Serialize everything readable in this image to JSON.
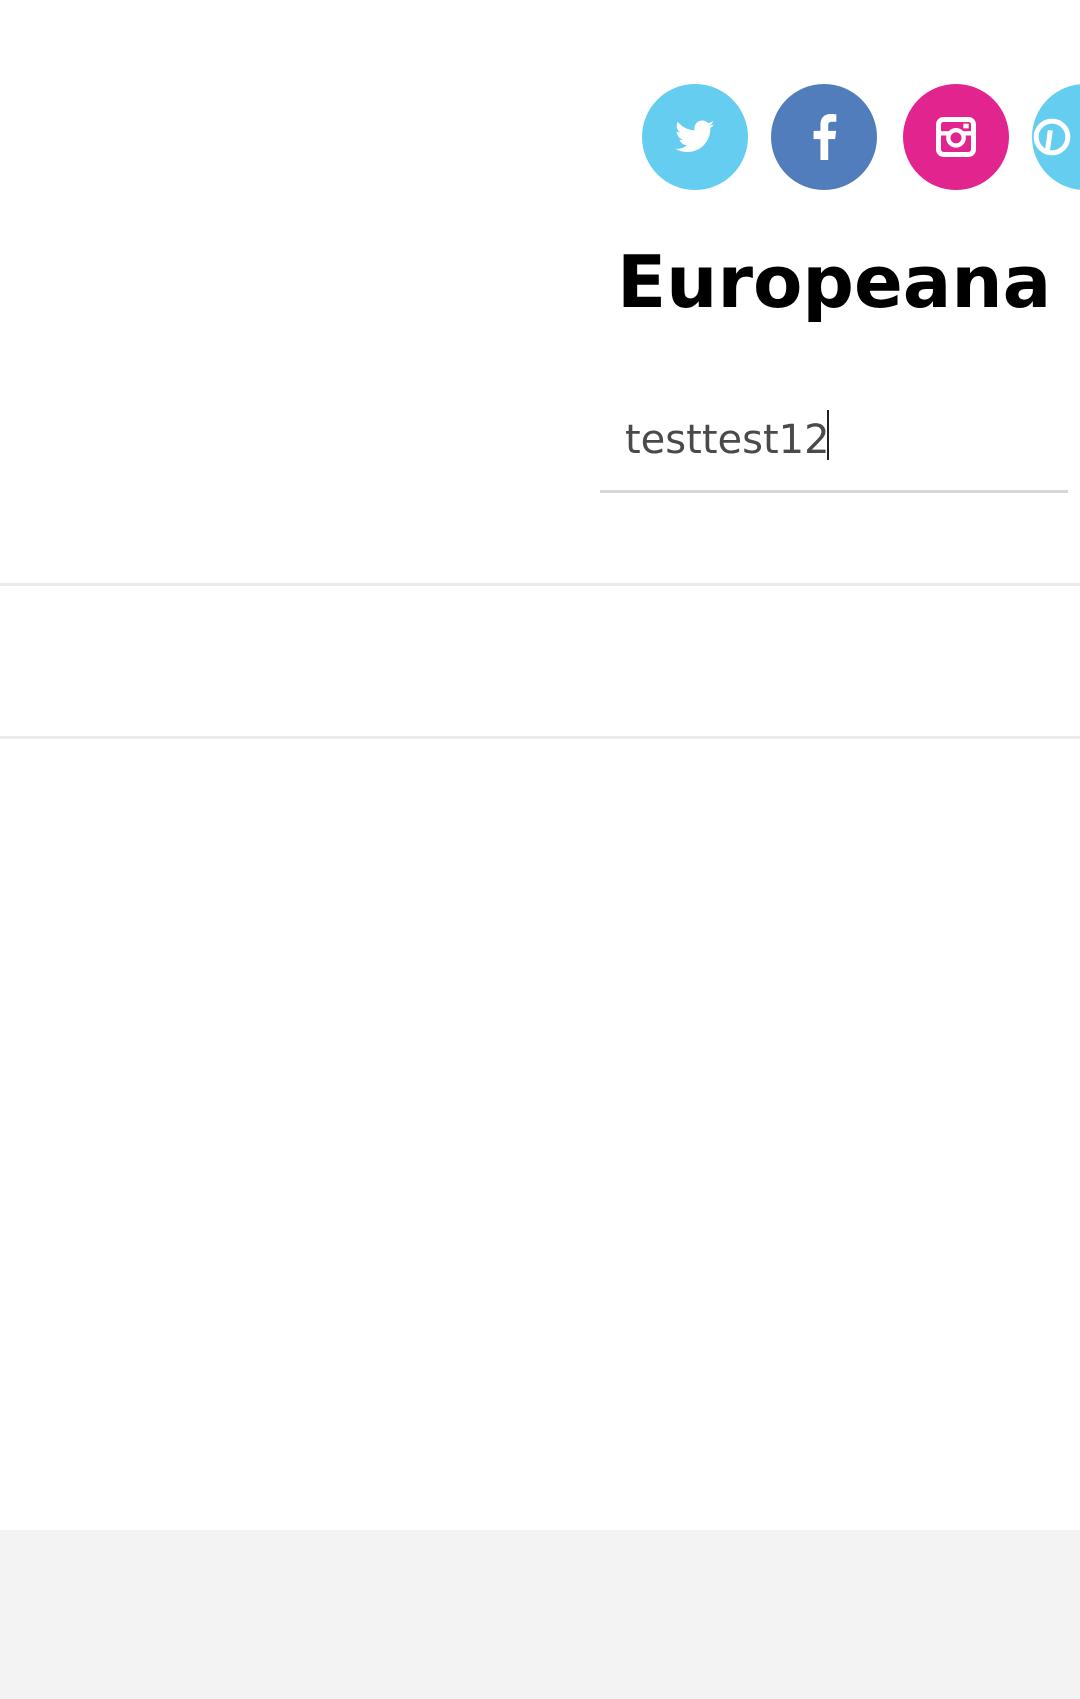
{
  "social": [
    {
      "name": "twitter",
      "icon": "twitter-icon",
      "color": "#64cdf0"
    },
    {
      "name": "facebook",
      "icon": "facebook-icon",
      "color": "#527dbd"
    },
    {
      "name": "instagram",
      "icon": "instagram-icon",
      "color": "#e2248f"
    },
    {
      "name": "pinterest",
      "icon": "pinterest-icon",
      "color": "#64cdf0"
    }
  ],
  "header": {
    "title": "Europeana Bl"
  },
  "search": {
    "value": "testtest12",
    "underline_color": "#d6d6d6"
  },
  "colors": {
    "background": "#ffffff",
    "footer": "#f3f3f3",
    "divider": "#ebebeb"
  }
}
